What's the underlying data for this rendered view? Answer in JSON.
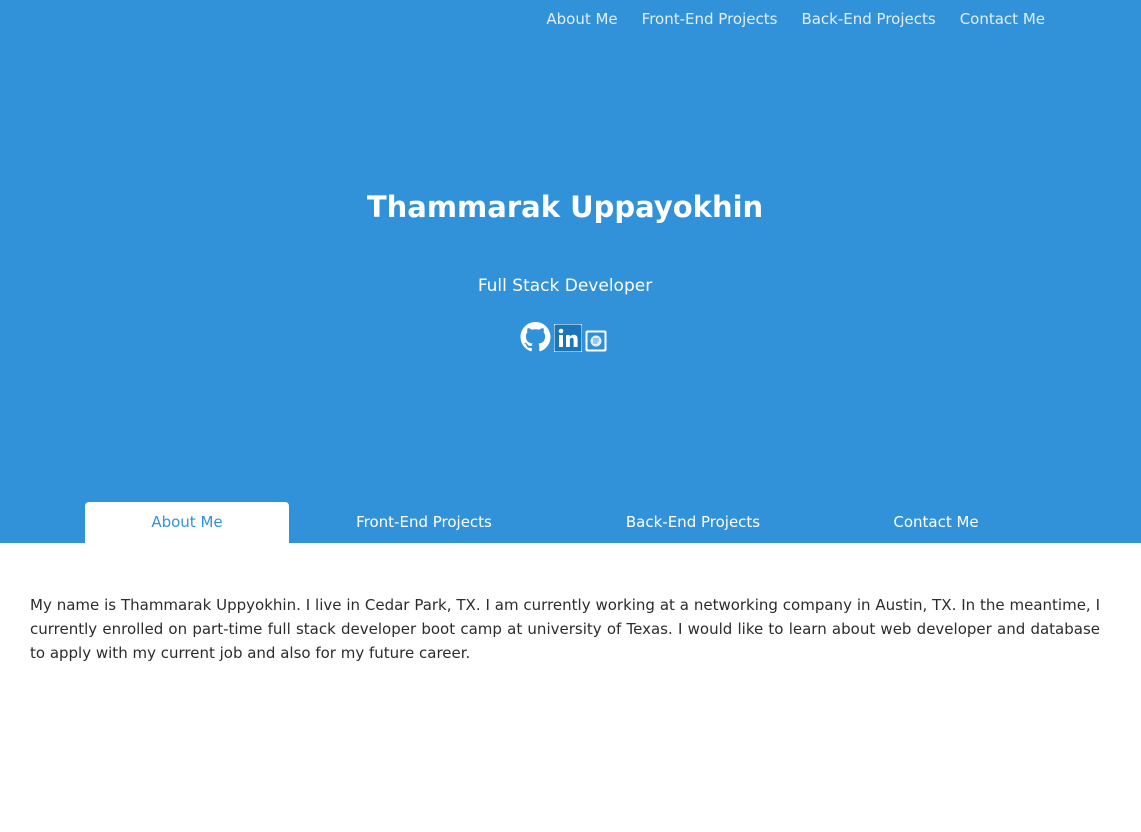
{
  "nav": {
    "items": [
      "About Me",
      "Front-End Projects",
      "Back-End Projects",
      "Contact Me"
    ]
  },
  "hero": {
    "name": "Thammarak Uppayokhin",
    "role": "Full Stack Developer",
    "socials": [
      {
        "icon": "github-icon"
      },
      {
        "icon": "linkedin-icon"
      },
      {
        "icon": "resume-icon"
      }
    ]
  },
  "tabs": {
    "items": [
      "About Me",
      "Front-End Projects",
      "Back-End Projects",
      "Contact Me"
    ],
    "active": "About Me"
  },
  "about": {
    "text": "My name is Thammarak Uppyokhin. I live in Cedar Park, TX. I am currently working at a networking company in Austin, TX. In the meantime, I currently enrolled on part-time full stack developer boot camp at university of Texas. I would like to learn about web developer and database to apply with my current job and also for my future career."
  },
  "colors": {
    "hero_bg": "#3192da",
    "linkedin": "#1b75bb",
    "text": "#2c2c2c"
  }
}
